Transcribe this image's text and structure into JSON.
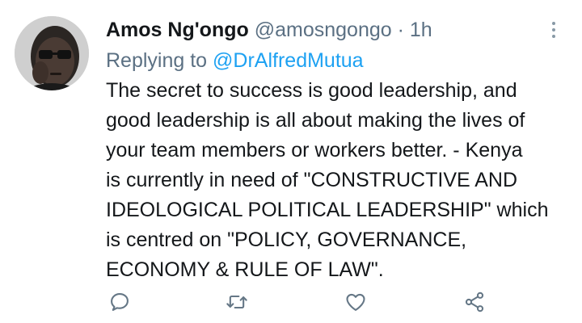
{
  "tweet": {
    "author_name": "Amos Ng'ongo",
    "author_handle": "@amosngongo",
    "separator": "·",
    "time": "1h",
    "reply_prefix": "Replying to",
    "reply_user": "@DrAlfredMutua",
    "body_lines": [
      "The secret to success is good leadership, and",
      "good leadership is all about making the lives of",
      "your team members or workers better. - Kenya",
      "is currently in need of \"CONSTRUCTIVE AND",
      "IDEOLOGICAL POLITICAL LEADERSHIP\" which",
      "is centred on \"POLICY, GOVERNANCE,",
      "ECONOMY & RULE OF LAW\"."
    ]
  },
  "actions": {
    "reply_icon": "reply-icon",
    "retweet_icon": "retweet-icon",
    "like_icon": "heart-icon",
    "share_icon": "share-icon",
    "more_icon": "more-vertical-icon"
  },
  "colors": {
    "text": "#14171a",
    "secondary": "#5b7083",
    "link": "#1da1f2",
    "icon": "#657786"
  }
}
